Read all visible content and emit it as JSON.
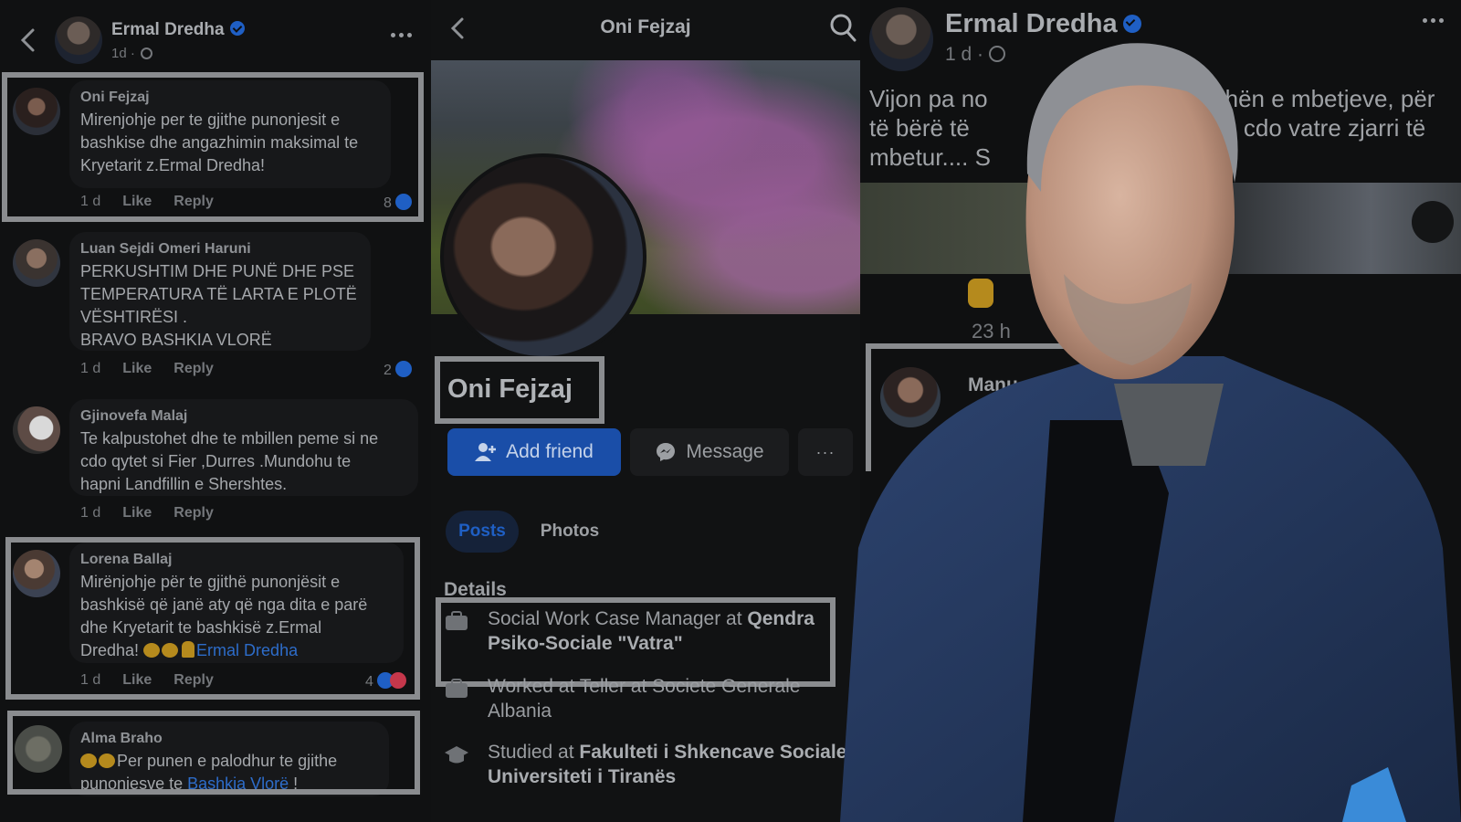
{
  "left": {
    "post_author": "Ermal Dredha",
    "post_meta": "1d ·",
    "comments": [
      {
        "name": "Oni Fejzaj",
        "text": "Mirenjohje per te gjithe punonjesit e\nbashkise dhe angazhimin maksimal te\nKryetarit z.Ermal Dredha!",
        "time": "1 d",
        "like": "Like",
        "reply": "Reply",
        "reactions": "8"
      },
      {
        "name": "Luan Sejdi Omeri Haruni",
        "text": "PERKUSHTIM DHE PUNË DHE PSE\nTEMPERATURA TË LARTA E PLOTË\nVËSHTIRËSI .\nBRAVO BASHKIA VLORË",
        "time": "1 d",
        "like": "Like",
        "reply": "Reply",
        "reactions": "2"
      },
      {
        "name": "Gjinovefa Malaj",
        "text": "Te kalpustohet dhe te mbillen peme si ne\ncdo qytet si Fier ,Durres .Mundohu te\nhapni Landfillin e Shershtes.",
        "time": "1 d",
        "like": "Like",
        "reply": "Reply",
        "reactions": ""
      },
      {
        "name": "Lorena Ballaj",
        "text_before": "Mirënjohje për te gjithë punonjësit e\nbashkisë që janë aty që nga dita e parë\ndhe Kryetarit te bashkisë z.Ermal\nDredha! ",
        "mention": "Ermal Dredha",
        "time": "1 d",
        "like": "Like",
        "reply": "Reply",
        "reactions": "4"
      },
      {
        "name": "Alma Braho",
        "text_before": "Per  punen e palodhur te gjithe\npunonjesve te ",
        "mention": "Bashkia Vlorë",
        "text_after": " !"
      }
    ]
  },
  "middle": {
    "title": "Oni Fejzaj",
    "profile_name": "Oni Fejzaj",
    "add_friend": "Add friend",
    "message": "Message",
    "more": "···",
    "tabs": [
      "Posts",
      "Photos"
    ],
    "details_heading": "Details",
    "details": [
      {
        "prefix": "Social Work Case Manager at ",
        "bold": "Qendra Psiko-Sociale \"Vatra\""
      },
      {
        "prefix": "Worked at Teller at Societe Generale Albania",
        "bold": ""
      },
      {
        "prefix": "Studied at ",
        "bold": "Fakulteti i Shkencave Sociale, Universiteti i Tiranës"
      }
    ]
  },
  "right": {
    "post_author": "Ermal Dredha",
    "post_meta": "1 d ·",
    "post_text_a": "Vijon pa no",
    "post_text_b": "hën e mbetjeve, për",
    "post_text_c": "të bërë të",
    "post_text_d": "cdo vatre zjarri të",
    "post_text_e": "mbetur.... S",
    "comment_time": "23 h",
    "comment_name": "Manu"
  },
  "colors": {
    "accent": "#1f5fc4",
    "highlight_box": "#8a8c8f",
    "background": "#0e0f10"
  }
}
